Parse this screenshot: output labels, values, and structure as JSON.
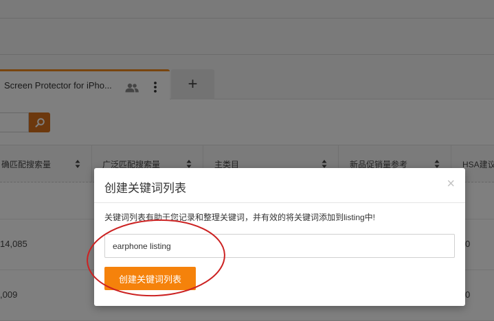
{
  "tab": {
    "title": "Screen Protector for iPho...",
    "add_label": "+"
  },
  "table": {
    "columns": [
      {
        "label": "确匹配搜索量"
      },
      {
        "label": "广泛匹配搜索量"
      },
      {
        "label": "主类目"
      },
      {
        "label": "新品促销量参考"
      },
      {
        "label": "HSA建议"
      }
    ],
    "rows": [
      {
        "col1": "14,085",
        "col5": "0"
      },
      {
        "col1": ",009",
        "col5": "0"
      }
    ]
  },
  "modal": {
    "title": "创建关键词列表",
    "close_symbol": "×",
    "description": "关键词列表有助于您记录和整理关键词，并有效的将关键词添加到listing中!",
    "input_value": "earphone listing",
    "button_label": "创建关键词列表"
  },
  "colors": {
    "accent": "#f5820b",
    "tab_border": "#f08a1c",
    "annotation": "#cc2222"
  }
}
